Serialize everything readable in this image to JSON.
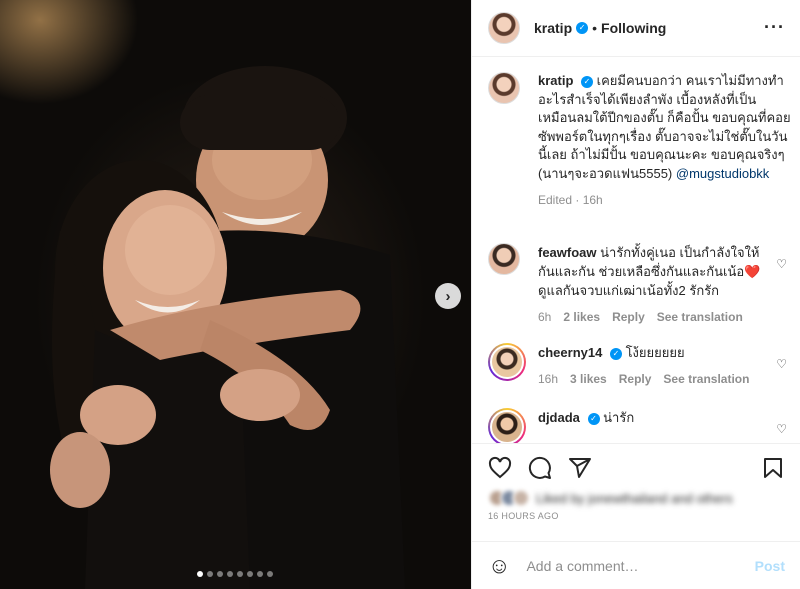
{
  "post": {
    "username": "kratip",
    "follow_status": "Following",
    "caption_text": "เคยมีคนบอกว่า คนเราไม่มีทางทำอะไรสำเร็จได้เพียงลำพัง เบื้องหลังที่เป็นเหมือนลมใต้ปีกของตั๊บ ก็คือปั้น ขอบคุณที่คอยซัพพอร์ตในทุกๆเรื่อง ตั๊บอาจจะไม่ใช่ตั๊บในวันนี้เลย ถ้าไม่มีปั้น ขอบคุณนะคะ ขอบคุณจริงๆ (นานๆจะอวดแฟน5555)",
    "caption_mention": "@mugstudiobkk",
    "caption_meta": "Edited · 16h",
    "carousel_count": 8,
    "carousel_active": 0
  },
  "comments": [
    {
      "username": "feawfoaw",
      "verified": false,
      "text": "น่ารักทั้งคู่เนอ เป็นกำลังใจให้กันและกัน ช่วยเหลือซึ่งกันและกันเน้อ❤️ดูแลกันจวบแก่เฒ่าเน้อทั้ง2 รักรัก",
      "age": "6h",
      "likes": "2 likes",
      "reply": "Reply",
      "translate": "See translation"
    },
    {
      "username": "cheerny14",
      "verified": true,
      "text": "โง้ยยยยยย",
      "age": "16h",
      "likes": "3 likes",
      "reply": "Reply",
      "translate": "See translation"
    },
    {
      "username": "djdada",
      "verified": true,
      "text": "น่ารัก"
    }
  ],
  "actions": {
    "timestamp": "16 HOURS AGO",
    "likes_text": "Liked by jonewthailand and others"
  },
  "add_comment": {
    "placeholder": "Add a comment…",
    "post_label": "Post"
  },
  "icons": {
    "verified": "verified-badge-icon",
    "more": "more-options-icon",
    "like": "heart-icon",
    "comment": "comment-icon",
    "share": "share-icon",
    "save": "bookmark-icon",
    "emoji": "emoji-icon",
    "next": "chevron-right-icon"
  },
  "colors": {
    "verified_blue": "#0095f6",
    "link_blue": "#00376b",
    "post_disabled": "#b2dffc",
    "heart_red": "#ed4956"
  }
}
